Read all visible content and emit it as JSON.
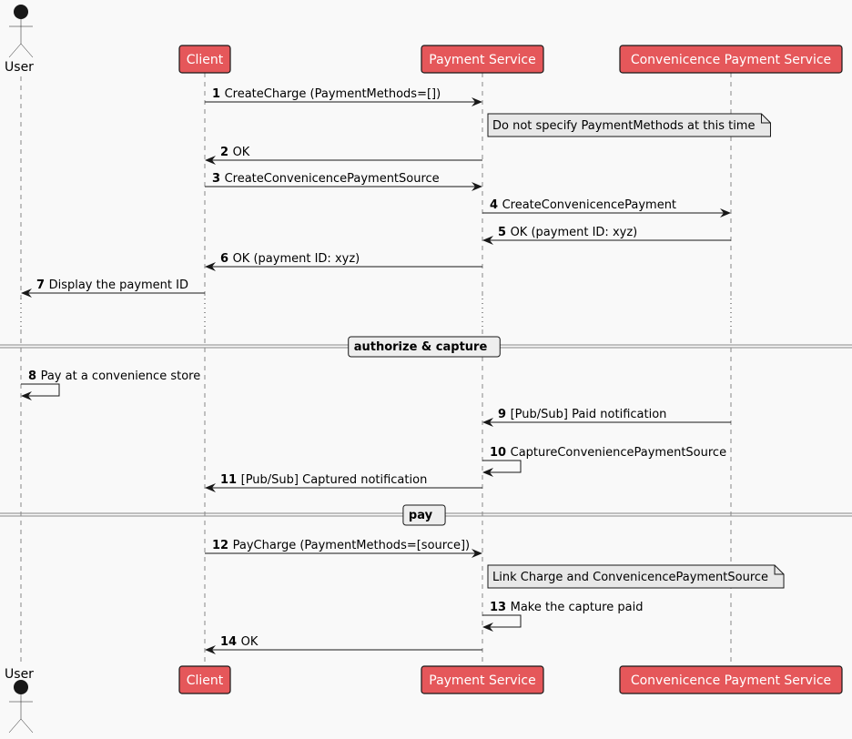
{
  "diagram": {
    "type": "sequence",
    "colors": {
      "participant_fill": "#e5575a",
      "participant_border": "#181818",
      "participant_text": "#ffffff",
      "note_fill": "#e8e8e8",
      "background": "#f9f9f9",
      "line": "#181818",
      "lifeline": "#888888"
    },
    "participants": [
      {
        "id": "user",
        "label": "User",
        "kind": "actor"
      },
      {
        "id": "client",
        "label": "Client",
        "kind": "participant"
      },
      {
        "id": "payment",
        "label": "Payment Service",
        "kind": "participant"
      },
      {
        "id": "conv",
        "label": "Convenicence  Payment Service",
        "kind": "participant"
      }
    ],
    "events": [
      {
        "type": "message",
        "num": "1",
        "text": "CreateCharge (PaymentMethods=[])",
        "from": "client",
        "to": "payment"
      },
      {
        "type": "note",
        "text": "Do not specify PaymentMethods at this time",
        "over": "payment"
      },
      {
        "type": "message",
        "num": "2",
        "text": "OK",
        "from": "payment",
        "to": "client"
      },
      {
        "type": "message",
        "num": "3",
        "text": "CreateConvenicencePaymentSource",
        "from": "client",
        "to": "payment"
      },
      {
        "type": "message",
        "num": "4",
        "text": "CreateConvenicencePayment",
        "from": "payment",
        "to": "conv"
      },
      {
        "type": "message",
        "num": "5",
        "text": "OK (payment ID: xyz)",
        "from": "conv",
        "to": "payment"
      },
      {
        "type": "message",
        "num": "6",
        "text": "OK (payment ID: xyz)",
        "from": "payment",
        "to": "client"
      },
      {
        "type": "message",
        "num": "7",
        "text": "Display the payment ID",
        "from": "client",
        "to": "user"
      },
      {
        "type": "delay"
      },
      {
        "type": "divider",
        "text": "authorize & capture"
      },
      {
        "type": "message",
        "num": "8",
        "text": "Pay at a convenience store",
        "from": "user",
        "to": "user"
      },
      {
        "type": "message",
        "num": "9",
        "text": "[Pub/Sub] Paid notification",
        "from": "conv",
        "to": "payment"
      },
      {
        "type": "message",
        "num": "10",
        "text": "CaptureConveniencePaymentSource",
        "from": "payment",
        "to": "payment"
      },
      {
        "type": "message",
        "num": "11",
        "text": "[Pub/Sub] Captured notification",
        "from": "payment",
        "to": "client"
      },
      {
        "type": "divider",
        "text": "pay"
      },
      {
        "type": "message",
        "num": "12",
        "text": "PayCharge (PaymentMethods=[source])",
        "from": "client",
        "to": "payment"
      },
      {
        "type": "note",
        "text": "Link Charge and ConvenicencePaymentSource",
        "over": "payment"
      },
      {
        "type": "message",
        "num": "13",
        "text": "Make the capture paid",
        "from": "payment",
        "to": "payment"
      },
      {
        "type": "message",
        "num": "14",
        "text": "OK",
        "from": "payment",
        "to": "client"
      }
    ]
  }
}
